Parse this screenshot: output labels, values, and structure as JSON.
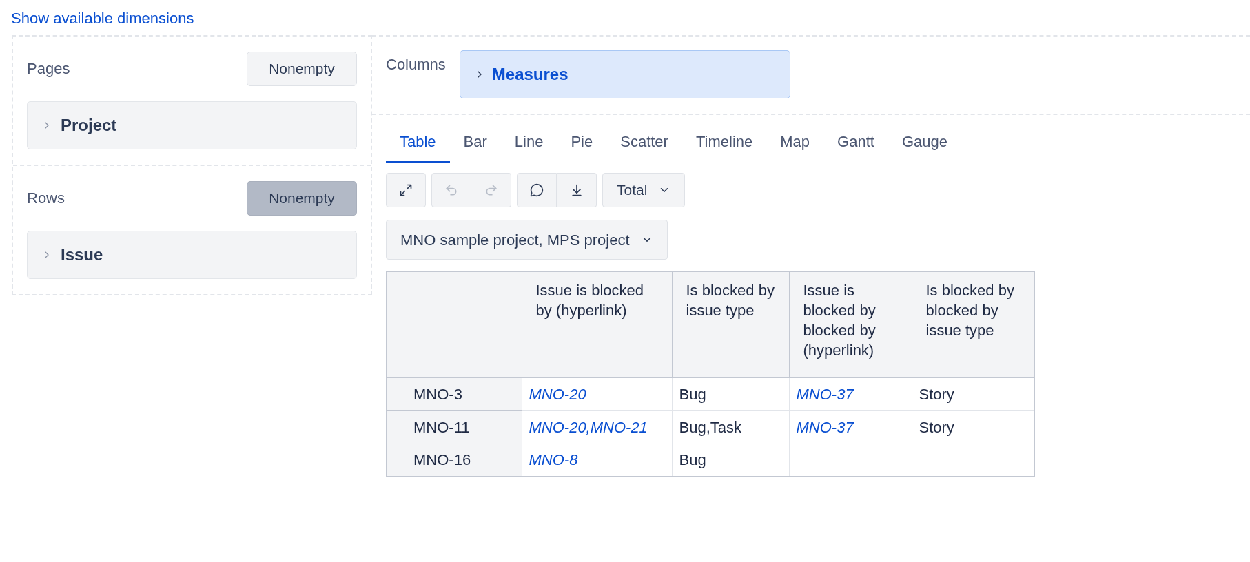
{
  "link": "Show available dimensions",
  "pages": {
    "title": "Pages",
    "toggle": {
      "label": "Nonempty",
      "selected": false
    },
    "items": [
      "Project"
    ]
  },
  "rows": {
    "title": "Rows",
    "toggle": {
      "label": "Nonempty",
      "selected": true
    },
    "items": [
      "Issue"
    ]
  },
  "columns": {
    "title": "Columns",
    "items": [
      "Measures"
    ]
  },
  "tabs": [
    {
      "label": "Table",
      "selected": true
    },
    {
      "label": "Bar",
      "selected": false
    },
    {
      "label": "Line",
      "selected": false
    },
    {
      "label": "Pie",
      "selected": false
    },
    {
      "label": "Scatter",
      "selected": false
    },
    {
      "label": "Timeline",
      "selected": false
    },
    {
      "label": "Map",
      "selected": false
    },
    {
      "label": "Gantt",
      "selected": false
    },
    {
      "label": "Gauge",
      "selected": false
    }
  ],
  "toolbar": {
    "undo_disabled": true,
    "redo_disabled": true,
    "total": "Total"
  },
  "filter": "MNO sample project, MPS project",
  "table": {
    "columns": [
      "Issue is blocked by (hyperlink)",
      "Is blocked by issue type",
      "Issue is blocked by blocked by (hyperlink)",
      "Is blocked by blocked by issue type"
    ],
    "rows": [
      {
        "header": "MNO-3",
        "cells": [
          {
            "kind": "link",
            "text": "MNO-20"
          },
          {
            "kind": "text",
            "text": "Bug"
          },
          {
            "kind": "link",
            "text": "MNO-37"
          },
          {
            "kind": "text",
            "text": "Story"
          }
        ]
      },
      {
        "header": "MNO-11",
        "cells": [
          {
            "kind": "link",
            "text": "MNO-20,MNO-21"
          },
          {
            "kind": "text",
            "text": "Bug,Task"
          },
          {
            "kind": "link",
            "text": "MNO-37"
          },
          {
            "kind": "text",
            "text": "Story"
          }
        ]
      },
      {
        "header": "MNO-16",
        "cells": [
          {
            "kind": "link",
            "text": "MNO-8"
          },
          {
            "kind": "text",
            "text": "Bug"
          },
          {
            "kind": "empty"
          },
          {
            "kind": "empty"
          }
        ]
      }
    ]
  }
}
